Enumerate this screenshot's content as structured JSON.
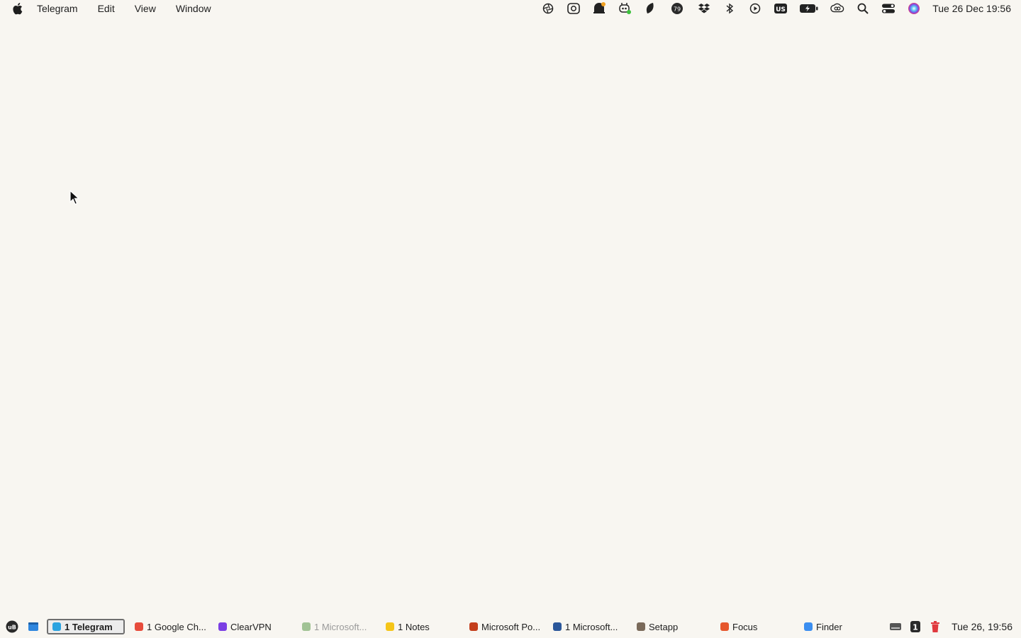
{
  "menubar": {
    "app_name": "Telegram",
    "items": [
      "Edit",
      "View",
      "Window"
    ],
    "status_icons": [
      "aperture-icon",
      "grammarly-icon",
      "notification-bell-icon",
      "copilot-icon",
      "leaf-icon",
      "speed-meter-icon",
      "dropbox-icon",
      "bluetooth-icon",
      "play-circle-icon",
      "keyboard-layout-icon",
      "battery-icon",
      "creative-cloud-icon",
      "spotlight-search-icon",
      "control-center-icon",
      "siri-icon"
    ],
    "keyboard_layout": "US",
    "meter_value": "79",
    "clock": "Tue 26 Dec  19:56"
  },
  "taskbar": {
    "left_icons": [
      "ublock-icon",
      "window-icon"
    ],
    "ublock_label": "uB",
    "tasks": [
      {
        "label": "1 Telegram",
        "color": "#2aa3e0",
        "active": true
      },
      {
        "label": "1 Google Ch...",
        "color": "#e74c3c",
        "active": false
      },
      {
        "label": "ClearVPN",
        "color": "#7b3fe4",
        "active": false
      },
      {
        "label": "1 Microsoft...",
        "color": "#4a8f3a",
        "active": false,
        "dim": true
      },
      {
        "label": "1 Notes",
        "color": "#f5c518",
        "active": false
      },
      {
        "label": "Microsoft Po...",
        "color": "#c43e1c",
        "active": false
      },
      {
        "label": "1 Microsoft...",
        "color": "#2b579a",
        "active": false
      },
      {
        "label": "Setapp",
        "color": "#7a6a5a",
        "active": false
      },
      {
        "label": "Focus",
        "color": "#e6572d",
        "active": false
      },
      {
        "label": "Finder",
        "color": "#3b8ef0",
        "active": false
      }
    ],
    "right_icons": [
      "drive-icon",
      "notification-count-icon",
      "trash-icon"
    ],
    "notification_count": "1",
    "date": "Tue 26, 19:56"
  }
}
